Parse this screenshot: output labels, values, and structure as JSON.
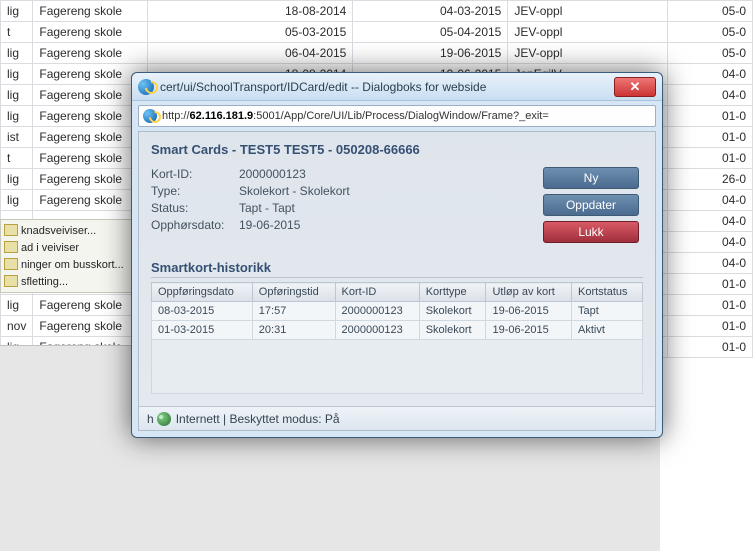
{
  "bg_rows": [
    {
      "c0": "lig",
      "c1": "Fagereng skole",
      "c2": "18-08-2014",
      "c3": "04-03-2015",
      "c4": "JEV-oppl",
      "c5": "05-0"
    },
    {
      "c0": "t",
      "c1": "Fagereng skole",
      "c2": "05-03-2015",
      "c3": "05-04-2015",
      "c4": "JEV-oppl",
      "c5": "05-0"
    },
    {
      "c0": "lig",
      "c1": "Fagereng skole",
      "c2": "06-04-2015",
      "c3": "19-06-2015",
      "c4": "JEV-oppl",
      "c5": "05-0"
    },
    {
      "c0": "lig",
      "c1": "Fagereng skole",
      "c2": "18-08-2014",
      "c3": "19-06-2015",
      "c4": "JanEgilV",
      "c5": "04-0"
    },
    {
      "c0": "lig",
      "c1": "Fagereng skole",
      "c2": "",
      "c3": "",
      "c4": "",
      "c5": "04-0"
    },
    {
      "c0": "lig",
      "c1": "Fagereng skole",
      "c2": "",
      "c3": "",
      "c4": "",
      "c5": "01-0"
    },
    {
      "c0": "ist",
      "c1": "Fagereng skole",
      "c2": "",
      "c3": "",
      "c4": "",
      "c5": "01-0"
    },
    {
      "c0": "t",
      "c1": "Fagereng skole",
      "c2": "",
      "c3": "",
      "c4": "",
      "c5": "01-0"
    },
    {
      "c0": "lig",
      "c1": "Fagereng skole",
      "c2": "",
      "c3": "",
      "c4": "",
      "c5": "26-0"
    },
    {
      "c0": "lig",
      "c1": "Fagereng skole",
      "c2": "",
      "c3": "",
      "c4": "",
      "c5": "04-0"
    },
    {
      "c0": "",
      "c1": "",
      "c2": "",
      "c3": "",
      "c4": "",
      "c5": "04-0"
    },
    {
      "c0": "",
      "c1": "",
      "c2": "",
      "c3": "",
      "c4": "",
      "c5": "04-0"
    },
    {
      "c0": "",
      "c1": "",
      "c2": "",
      "c3": "",
      "c4": "",
      "c5": "04-0"
    },
    {
      "c0": "",
      "c1": "",
      "c2": "",
      "c3": "",
      "c4": "",
      "c5": "01-0"
    },
    {
      "c0": "lig",
      "c1": "Fagereng skole",
      "c2": "",
      "c3": "",
      "c4": "",
      "c5": "01-0"
    },
    {
      "c0": "nov",
      "c1": "Fagereng skole",
      "c2": "",
      "c3": "",
      "c4": "",
      "c5": "01-0"
    },
    {
      "c0": "lig",
      "c1": "Fagereng skole",
      "c2": "",
      "c3": "",
      "c4": "",
      "c5": "01-0"
    }
  ],
  "tasks": [
    "knadsveiviser...",
    "ad i veiviser",
    "ninger om busskort...",
    "sfletting..."
  ],
  "dialog": {
    "title": "cert/ui/SchoolTransport/IDCard/edit -- Dialogboks for webside",
    "url_prefix": "http://",
    "url_bold": "62.116.181.9",
    "url_rest": ":5001/App/Core/UI/Lib/Process/DialogWindow/Frame?_exit=",
    "heading": "Smart Cards - TEST5 TEST5 - 050208-66666",
    "kv": {
      "kort_id_lbl": "Kort-ID:",
      "kort_id": "2000000123",
      "type_lbl": "Type:",
      "type": "Skolekort - Skolekort",
      "status_lbl": "Status:",
      "status_val": "Tapt - Tapt",
      "opph_lbl": "Opphørsdato:",
      "opph": "19-06-2015"
    },
    "buttons": {
      "ny": "Ny",
      "oppdater": "Oppdater",
      "lukk": "Lukk"
    },
    "hist_title": "Smartkort-historikk",
    "hist_headers": [
      "Oppføringsdato",
      "Opføringstid",
      "Kort-ID",
      "Korttype",
      "Utløp av kort",
      "Kortstatus"
    ],
    "hist_rows": [
      {
        "d": "08-03-2015",
        "t": "17:57",
        "id": "2000000123",
        "ty": "Skolekort",
        "ex": "19-06-2015",
        "st": "Tapt"
      },
      {
        "d": "01-03-2015",
        "t": "20:31",
        "id": "2000000123",
        "ty": "Skolekort",
        "ex": "19-06-2015",
        "st": "Aktivt"
      }
    ],
    "status_h": "h",
    "status_text": "Internett | Beskyttet modus: På"
  }
}
